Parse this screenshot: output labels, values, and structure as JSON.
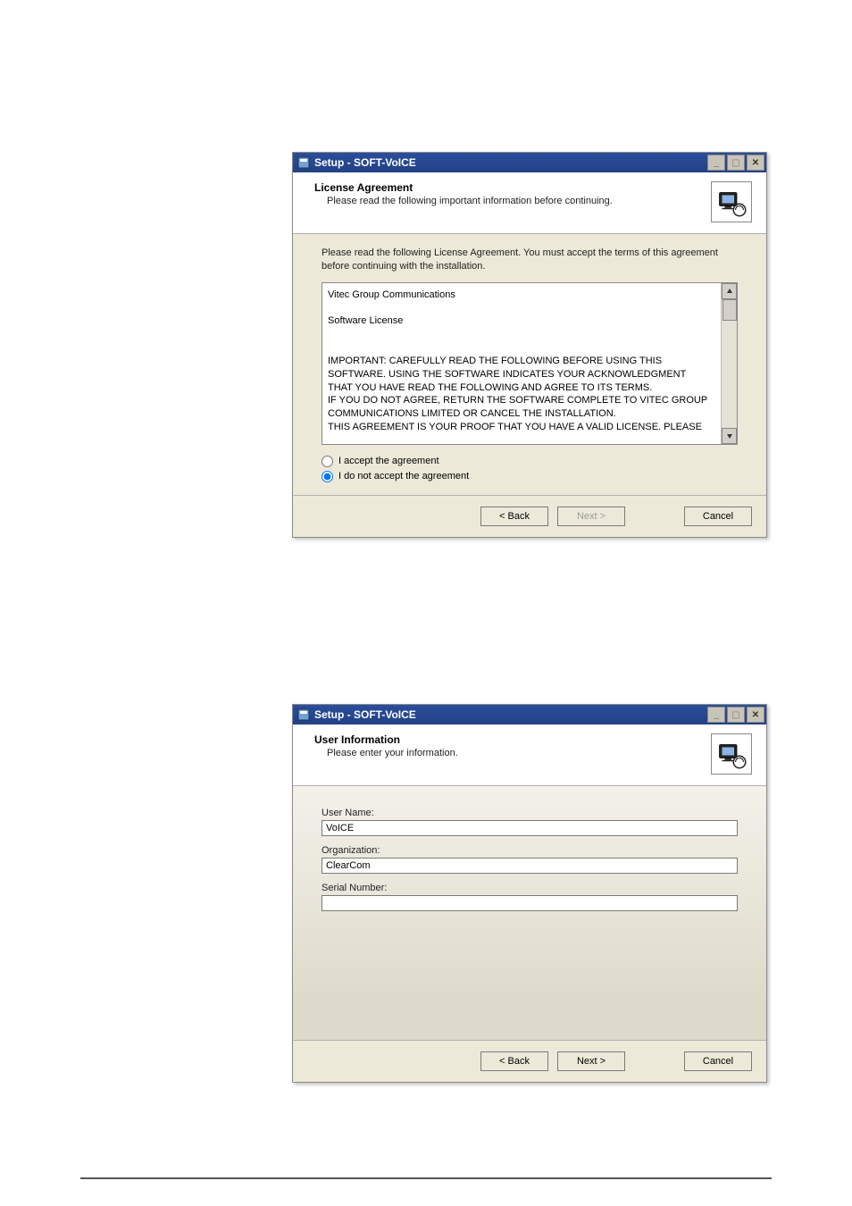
{
  "dlg1": {
    "title": "Setup - SOFT-VoICE",
    "header": {
      "title": "License Agreement",
      "subtitle": "Please read the following important information before continuing."
    },
    "instruction": "Please read the following License Agreement. You must accept the terms of this agreement before continuing with the installation.",
    "license_text_lines": [
      "Vitec Group Communications",
      "",
      "Software License",
      "",
      "",
      "IMPORTANT:  CAREFULLY READ THE FOLLOWING BEFORE USING THIS",
      "SOFTWARE.  USING THE SOFTWARE INDICATES YOUR ACKNOWLEDGMENT",
      "THAT YOU HAVE READ THE FOLLOWING AND AGREE TO ITS TERMS.",
      "IF YOU DO NOT AGREE, RETURN THE SOFTWARE COMPLETE TO VITEC GROUP",
      "COMMUNICATIONS LIMITED OR CANCEL THE INSTALLATION.",
      "THIS AGREEMENT IS YOUR PROOF THAT YOU HAVE A VALID LICENSE.  PLEASE"
    ],
    "radio_accept": "I accept the agreement",
    "radio_decline": "I do not accept the agreement",
    "btn_back": "< Back",
    "btn_next": "Next >",
    "btn_cancel": "Cancel"
  },
  "dlg2": {
    "title": "Setup - SOFT-VoICE",
    "header": {
      "title": "User Information",
      "subtitle": "Please enter your information."
    },
    "labels": {
      "username": "User Name:",
      "org": "Organization:",
      "serial": "Serial Number:"
    },
    "values": {
      "username": "VoICE",
      "org": "ClearCom",
      "serial": ""
    },
    "btn_back": "< Back",
    "btn_next": "Next >",
    "btn_cancel": "Cancel"
  }
}
